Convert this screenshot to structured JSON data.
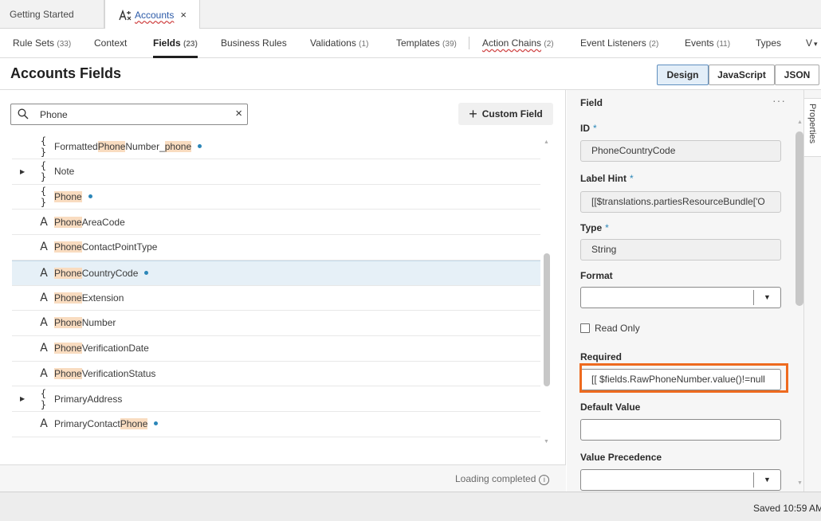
{
  "doc_tabs": [
    {
      "label": "Getting Started"
    },
    {
      "label": "Accounts",
      "close": "×"
    }
  ],
  "sub_tabs": [
    {
      "label": "Rule Sets",
      "count": "(33)"
    },
    {
      "label": "Context",
      "count": ""
    },
    {
      "label": "Fields",
      "count": "(23)"
    },
    {
      "label": "Business Rules",
      "count": ""
    },
    {
      "label": "Validations",
      "count": "(1)"
    },
    {
      "label": "Templates",
      "count": "(39)"
    },
    {
      "label": "Action Chains",
      "count": "(2)"
    },
    {
      "label": "Event Listeners",
      "count": "(2)"
    },
    {
      "label": "Events",
      "count": "(11)"
    },
    {
      "label": "Types",
      "count": ""
    },
    {
      "label": "V",
      "count": ""
    }
  ],
  "header": {
    "title": "Accounts Fields",
    "modes": [
      "Design",
      "JavaScript",
      "JSON"
    ]
  },
  "search": {
    "value": "Phone",
    "clear": "×"
  },
  "custom_field_button": {
    "plus": "+",
    "label": "Custom Field"
  },
  "fields": [
    {
      "pre": "Formatted",
      "hl": "Phone",
      "mid": "Number_",
      "hl2": "phone",
      "post": "",
      "type": "object",
      "dot": true,
      "caret": false
    },
    {
      "pre": "Note",
      "hl": "",
      "mid": "",
      "hl2": "",
      "post": "",
      "type": "object",
      "dot": false,
      "caret": true
    },
    {
      "pre": "",
      "hl": "Phone",
      "mid": "",
      "hl2": "",
      "post": "",
      "type": "object",
      "dot": true,
      "caret": false
    },
    {
      "pre": "",
      "hl": "Phone",
      "mid": "AreaCode",
      "hl2": "",
      "post": "",
      "type": "string",
      "dot": false,
      "caret": false
    },
    {
      "pre": "",
      "hl": "Phone",
      "mid": "ContactPointType",
      "hl2": "",
      "post": "",
      "type": "string",
      "dot": false,
      "caret": false
    },
    {
      "pre": "",
      "hl": "Phone",
      "mid": "CountryCode",
      "hl2": "",
      "post": "",
      "type": "string",
      "dot": true,
      "caret": false,
      "selected": true
    },
    {
      "pre": "",
      "hl": "Phone",
      "mid": "Extension",
      "hl2": "",
      "post": "",
      "type": "string",
      "dot": false,
      "caret": false
    },
    {
      "pre": "",
      "hl": "Phone",
      "mid": "Number",
      "hl2": "",
      "post": "",
      "type": "string",
      "dot": false,
      "caret": false
    },
    {
      "pre": "",
      "hl": "Phone",
      "mid": "VerificationDate",
      "hl2": "",
      "post": "",
      "type": "string",
      "dot": false,
      "caret": false
    },
    {
      "pre": "",
      "hl": "Phone",
      "mid": "VerificationStatus",
      "hl2": "",
      "post": "",
      "type": "string",
      "dot": false,
      "caret": false
    },
    {
      "pre": "PrimaryAddress",
      "hl": "",
      "mid": "",
      "hl2": "",
      "post": "",
      "type": "object",
      "dot": false,
      "caret": true
    },
    {
      "pre": "PrimaryContact",
      "hl": "Phone",
      "mid": "",
      "hl2": "",
      "post": "",
      "type": "string",
      "dot": true,
      "caret": false
    }
  ],
  "list_footer": {
    "status": "Loading completed",
    "info_icon": "i"
  },
  "properties": {
    "section_title": "Field",
    "more": "···",
    "id_label": "ID",
    "id_value": "PhoneCountryCode",
    "label_hint_label": "Label Hint",
    "label_hint_value": "[[$translations.partiesResourceBundle['O",
    "type_label": "Type",
    "type_value": "String",
    "format_label": "Format",
    "format_value": "",
    "read_only_label": "Read Only",
    "required_label": "Required",
    "required_value": "[[ $fields.RawPhoneNumber.value()!=null",
    "default_value_label": "Default Value",
    "default_value": "",
    "value_precedence_label": "Value Precedence",
    "value_precedence_value": "",
    "required_marker": "*",
    "side_tab": "Properties"
  },
  "status_bar": {
    "saved": "Saved 10:59 AM"
  },
  "colors": {
    "accent": "#2b86b8",
    "highlight_border": "#ee6a1f",
    "search_match": "#f9dcc0",
    "selected_row": "#e6f0f7"
  }
}
